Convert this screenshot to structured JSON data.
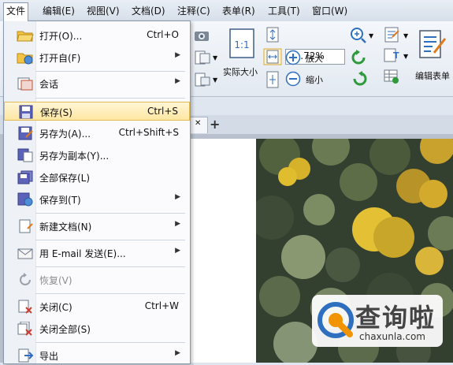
{
  "menubar": {
    "items": [
      "文件",
      "编辑(E)",
      "视图(V)",
      "文档(D)",
      "注释(C)",
      "表单(R)",
      "工具(T)",
      "窗口(W)"
    ]
  },
  "file_menu": {
    "items": [
      {
        "label": "打开(O)...",
        "shortcut": "Ctrl+O",
        "icon": "folder-open-icon"
      },
      {
        "label": "打开自(F)",
        "submenu": "▶",
        "icon": "folder-globe-icon"
      },
      {
        "label": "会话",
        "submenu": "▶",
        "icon": "session-icon"
      },
      {
        "label": "保存(S)",
        "shortcut": "Ctrl+S",
        "icon": "floppy-icon",
        "highlighted": true
      },
      {
        "label": "另存为(A)...",
        "shortcut": "Ctrl+Shift+S",
        "icon": "save-as-icon"
      },
      {
        "label": "另存为副本(Y)...",
        "icon": "save-copy-icon"
      },
      {
        "label": "全部保存(L)",
        "icon": "save-all-icon"
      },
      {
        "label": "保存到(T)",
        "submenu": "▶",
        "icon": "save-to-icon"
      },
      {
        "label": "新建文档(N)",
        "submenu": "▶",
        "icon": "new-doc-icon"
      },
      {
        "label": "用 E-mail 发送(E)...",
        "submenu": "▶",
        "icon": "email-icon"
      },
      {
        "label": "恢复(V)",
        "icon": "revert-icon",
        "disabled": true
      },
      {
        "label": "关闭(C)",
        "shortcut": "Ctrl+W",
        "icon": "close-doc-icon"
      },
      {
        "label": "关闭全部(S)",
        "icon": "close-all-icon"
      },
      {
        "label": "导出",
        "submenu": "▶",
        "icon": "export-icon"
      }
    ]
  },
  "toolbar": {
    "zoom_value": "91.72%",
    "actual_size_label": "实际大小",
    "zoom_in_label": "放大",
    "zoom_out_label": "缩小",
    "edit_form_label": "编辑表单",
    "fit_icon_text": "1:1"
  },
  "doc_tab": {
    "close": "✕",
    "add": "+"
  },
  "watermark": {
    "title": "查询啦",
    "url": "chaxunla.com"
  },
  "colors": {
    "accent": "#2f6fc0",
    "highlight": "#ffe7a3",
    "brand_orange": "#f29400"
  }
}
